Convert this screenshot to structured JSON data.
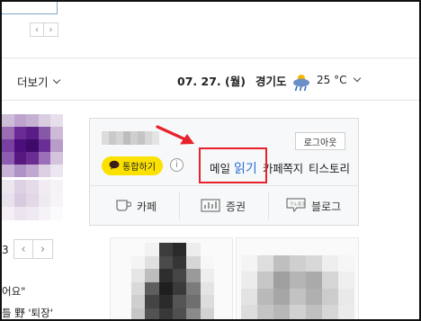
{
  "top": {
    "pager_prev": "‹",
    "pager_next": "›"
  },
  "nav": {
    "more_label": "더보기"
  },
  "header": {
    "date": "07. 27. (월)",
    "region": "경기도",
    "temperature": "25 °C",
    "weather_icon": "rain-cloud-icon"
  },
  "login_panel": {
    "logout_label": "로그아웃",
    "talk_button_label": "통합하기",
    "info_label": "i",
    "services": {
      "mail_label": "메일",
      "read_label": "읽기",
      "note_label": "카페쪽지",
      "tistory_label": "티스토리"
    },
    "quick_links": {
      "cafe_label": "카페",
      "stock_label": "증권",
      "blog_label": "블로그"
    }
  },
  "left_column": {
    "page_number": "3",
    "pager_prev": "‹",
    "pager_next": "›",
    "snippet_1": "어요\"",
    "snippet_2": "틀 野 '퇴장'"
  },
  "colors": {
    "accent_blue": "#2a6fd6",
    "talk_yellow": "#fae100",
    "highlight_red": "#e8212b"
  }
}
